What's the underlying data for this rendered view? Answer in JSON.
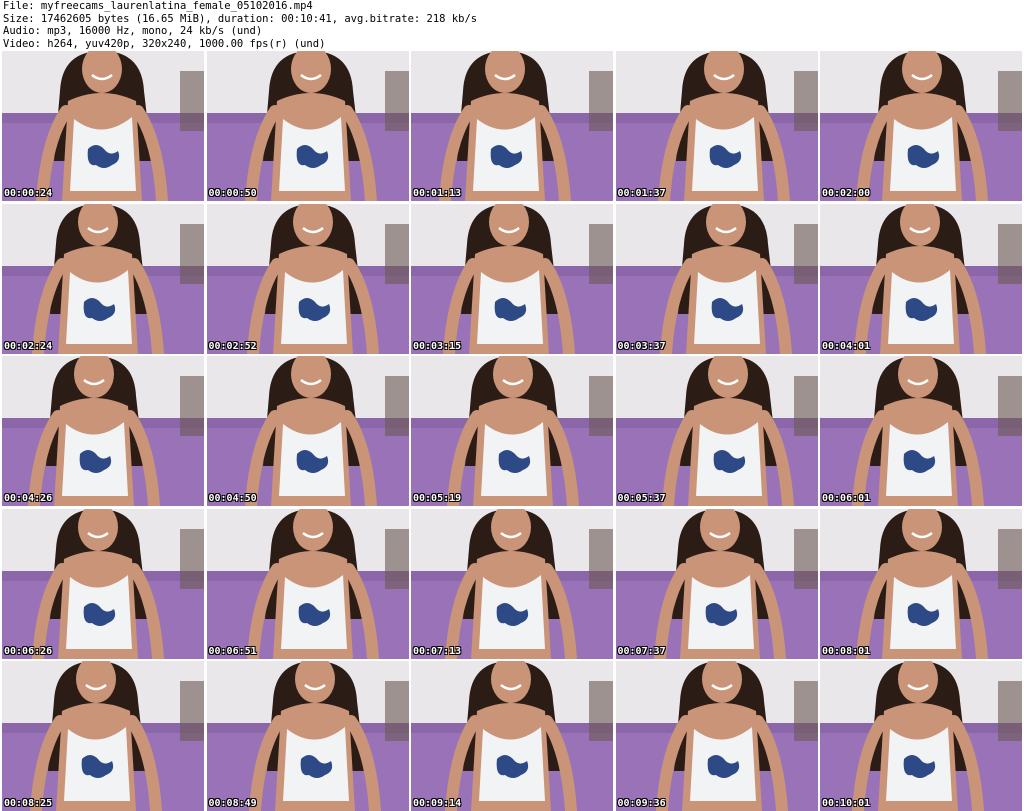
{
  "header": {
    "file_line": "File: myfreecams_laurenlatina_female_05102016.mp4",
    "size_line": "Size: 17462605 bytes (16.65 MiB), duration: 00:10:41, avg.bitrate: 218 kb/s",
    "audio_line": "Audio: mp3, 16000 Hz, mono, 24 kb/s (und)",
    "video_line": "Video: h264, yuv420p, 320x240, 1000.00 fps(r) (und)"
  },
  "thumbnails": [
    {
      "timestamp": "00:00:24"
    },
    {
      "timestamp": "00:00:50"
    },
    {
      "timestamp": "00:01:13"
    },
    {
      "timestamp": "00:01:37"
    },
    {
      "timestamp": "00:02:00"
    },
    {
      "timestamp": "00:02:24"
    },
    {
      "timestamp": "00:02:52"
    },
    {
      "timestamp": "00:03:15"
    },
    {
      "timestamp": "00:03:37"
    },
    {
      "timestamp": "00:04:01"
    },
    {
      "timestamp": "00:04:26"
    },
    {
      "timestamp": "00:04:50"
    },
    {
      "timestamp": "00:05:19"
    },
    {
      "timestamp": "00:05:37"
    },
    {
      "timestamp": "00:06:01"
    },
    {
      "timestamp": "00:06:26"
    },
    {
      "timestamp": "00:06:51"
    },
    {
      "timestamp": "00:07:13"
    },
    {
      "timestamp": "00:07:37"
    },
    {
      "timestamp": "00:08:01"
    },
    {
      "timestamp": "00:08:25"
    },
    {
      "timestamp": "00:08:49"
    },
    {
      "timestamp": "00:09:14"
    },
    {
      "timestamp": "00:09:36"
    },
    {
      "timestamp": "00:10:01"
    }
  ],
  "colors": {
    "wall": "#e9e7ea",
    "bed": "#9a72b8",
    "bed_shadow": "#7f5c9c",
    "skin": "#c99478",
    "hair": "#2b1c16",
    "top": "#f2f3f5",
    "print": "#2e4a86",
    "timestamp_text": "#ffffff"
  }
}
